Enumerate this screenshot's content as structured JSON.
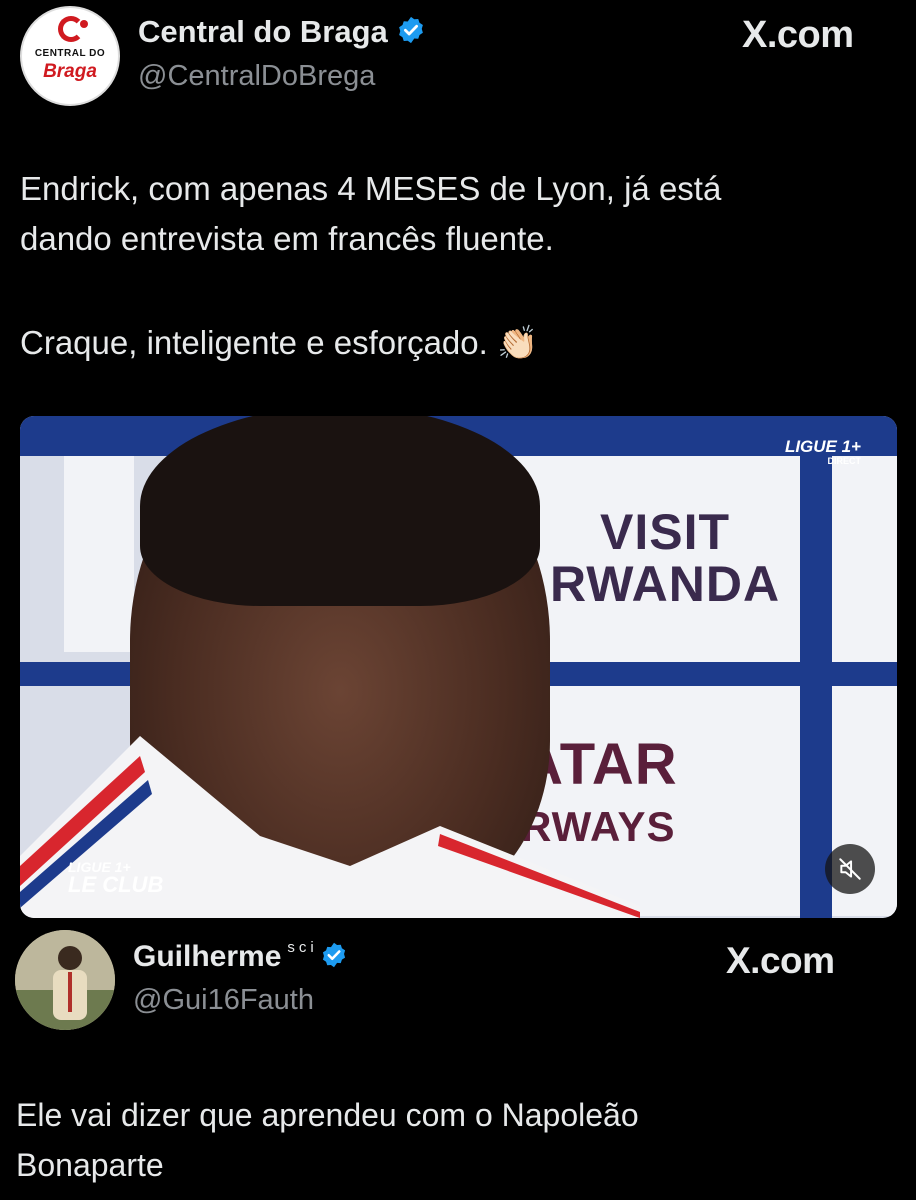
{
  "tweet1": {
    "display_name": "Central do Braga",
    "handle": "@CentralDoBrega",
    "brand": "X.com",
    "avatar_logo_top": "CENTRAL DO",
    "avatar_logo_bottom": "Braga",
    "text_lines": [
      "Endrick, com apenas 4 MESES de Lyon, já está",
      "dando entrevista em francês fluente."
    ],
    "text_line_2": "Craque, inteligente e esforçado. 👏🏻"
  },
  "media": {
    "sponsor_1_line1": "VISIT",
    "sponsor_1_line2": "RWANDA",
    "sponsor_2_line1": "QATAR",
    "sponsor_2_line2": "AIRWAYS",
    "ligue_top": "LIGUE 1+",
    "ligue_top_sub": "DIRECT",
    "ligue_club_line1": "LIGUE 1+",
    "ligue_club_line2": "LE CLUB",
    "mute_icon": "speaker-muted-icon"
  },
  "tweet2": {
    "display_name": "Guilherme",
    "name_suffix": "sci",
    "handle": "@Gui16Fauth",
    "brand": "X.com",
    "text_lines": [
      "Ele vai dizer que aprendeu com o Napoleão",
      "Bonaparte"
    ]
  },
  "colors": {
    "background": "#000000",
    "text": "#e7e9ea",
    "handle": "#8b8f94",
    "verified": "#1d9bf0"
  }
}
